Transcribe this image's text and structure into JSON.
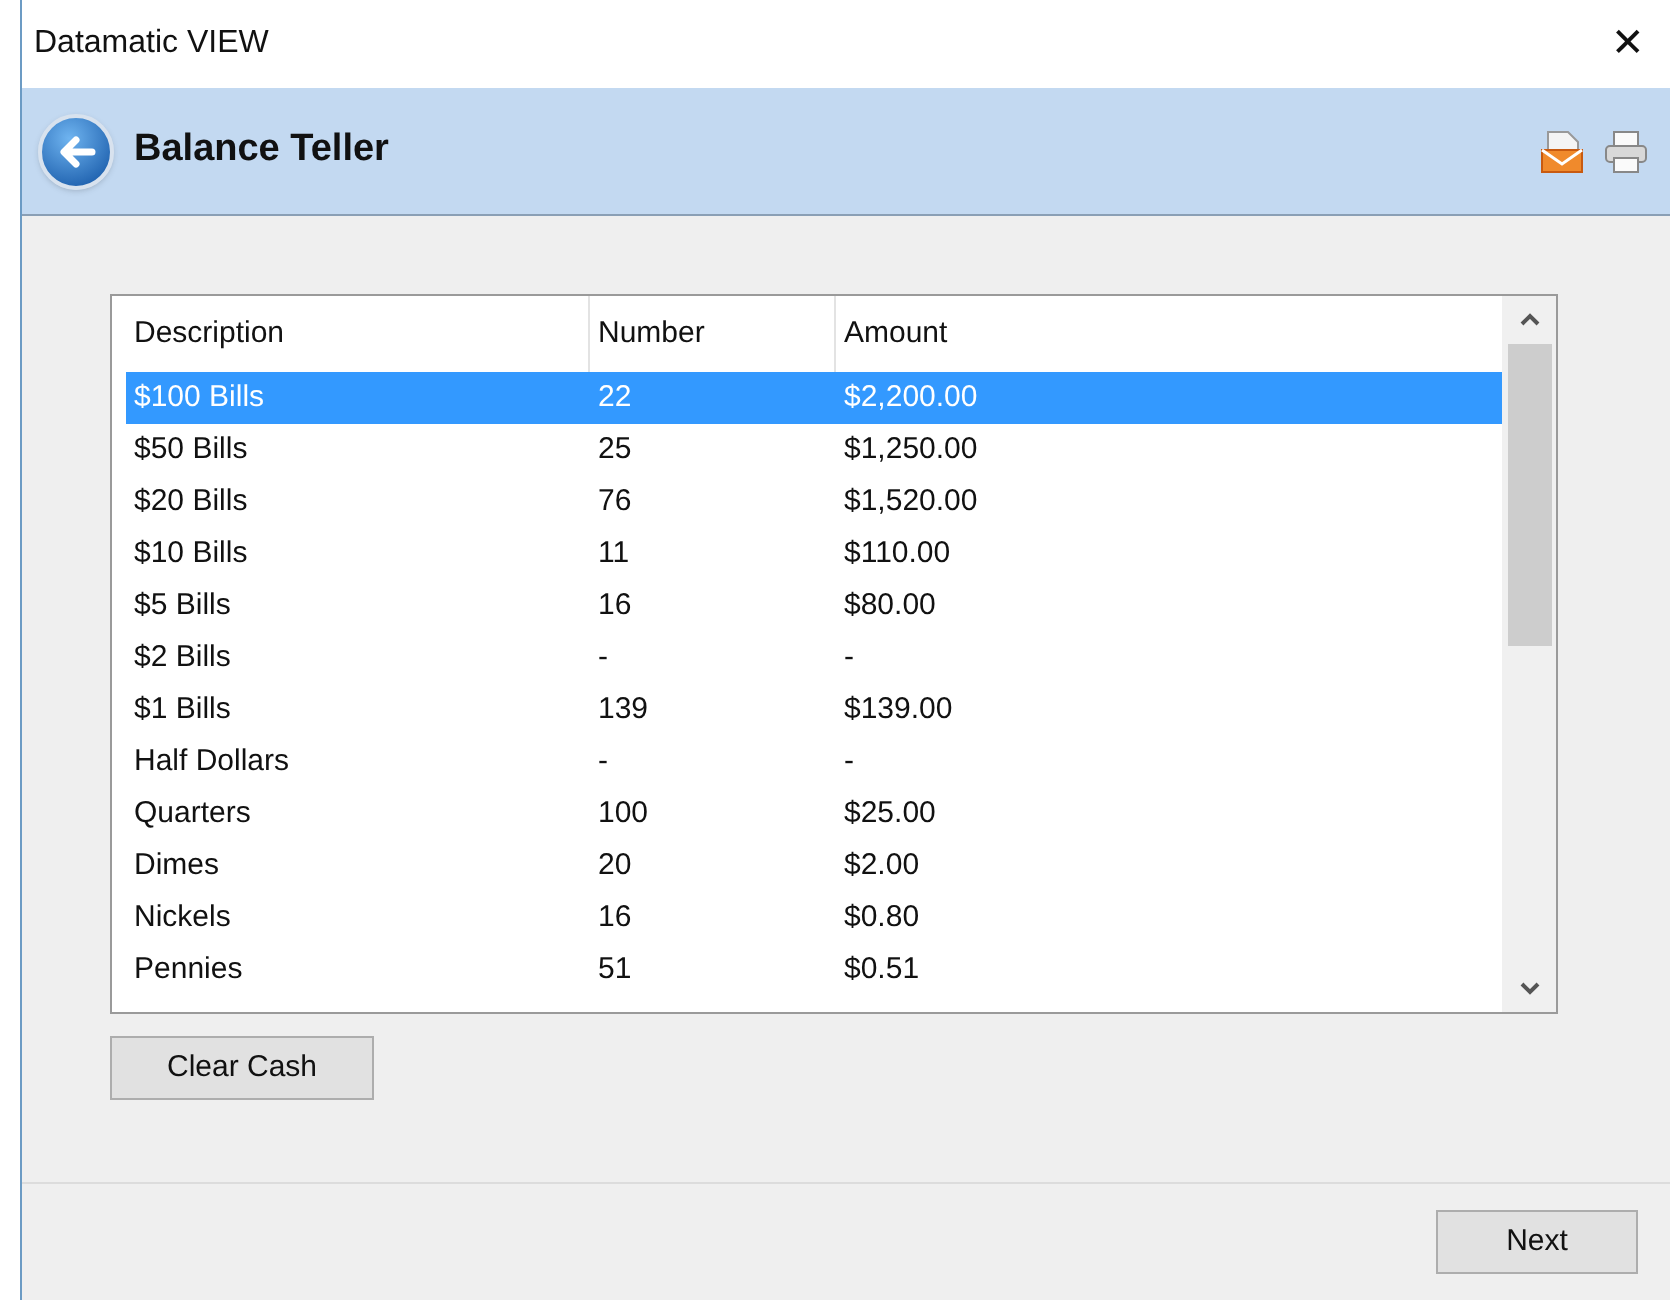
{
  "window": {
    "title": "Datamatic VIEW",
    "close": "✕"
  },
  "header": {
    "title": "Balance Teller"
  },
  "table": {
    "columns": [
      "Description",
      "Number",
      "Amount"
    ],
    "rows": [
      {
        "cells": [
          "$100 Bills",
          "22",
          "$2,200.00"
        ],
        "selected": true
      },
      {
        "cells": [
          "$50 Bills",
          "25",
          "$1,250.00"
        ],
        "selected": false
      },
      {
        "cells": [
          "$20 Bills",
          "76",
          "$1,520.00"
        ],
        "selected": false
      },
      {
        "cells": [
          "$10 Bills",
          "11",
          "$110.00"
        ],
        "selected": false
      },
      {
        "cells": [
          "$5 Bills",
          "16",
          "$80.00"
        ],
        "selected": false
      },
      {
        "cells": [
          "$2 Bills",
          "-",
          "-"
        ],
        "selected": false
      },
      {
        "cells": [
          "$1 Bills",
          "139",
          "$139.00"
        ],
        "selected": false
      },
      {
        "cells": [
          "Half Dollars",
          "-",
          "-"
        ],
        "selected": false
      },
      {
        "cells": [
          "Quarters",
          "100",
          "$25.00"
        ],
        "selected": false
      },
      {
        "cells": [
          "Dimes",
          "20",
          "$2.00"
        ],
        "selected": false
      },
      {
        "cells": [
          "Nickels",
          "16",
          "$0.80"
        ],
        "selected": false
      },
      {
        "cells": [
          "Pennies",
          "51",
          "$0.51"
        ],
        "selected": false
      }
    ]
  },
  "buttons": {
    "clear": "Clear Cash",
    "next": "Next"
  }
}
